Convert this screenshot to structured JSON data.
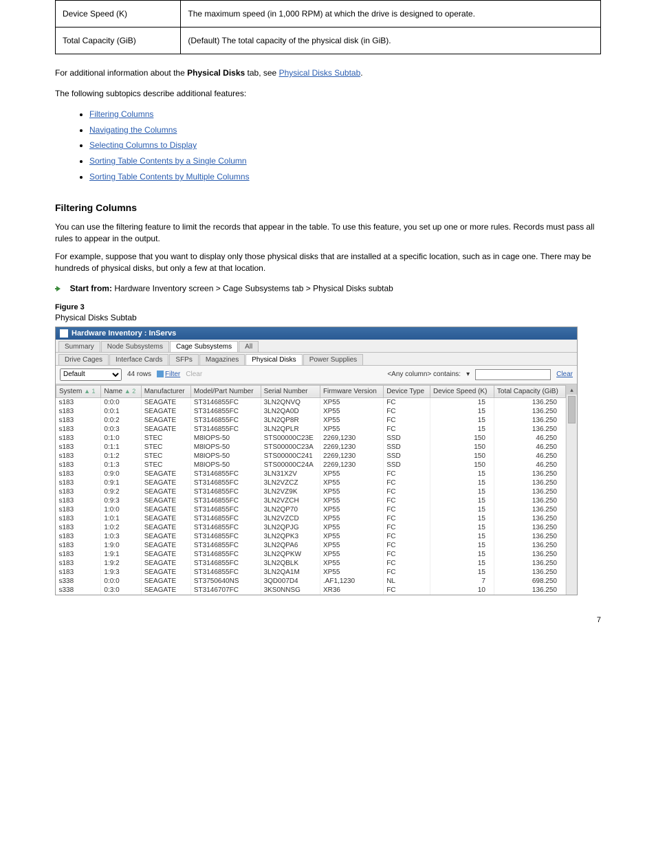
{
  "definitions": [
    {
      "term": "Device Speed (K)",
      "desc": "The maximum speed (in 1,000 RPM) at which the drive is designed to operate."
    },
    {
      "term": "Total Capacity (GiB)",
      "desc": "(Default) The total capacity of the physical disk (in GiB)."
    }
  ],
  "intro": {
    "prefix": "For additional information about the ",
    "bold": "Physical Disks",
    "mid": " tab, see ",
    "link": "Physical Disks Subtab",
    "suffix": "."
  },
  "toc_intro": "The following subtopics describe additional features:",
  "toc": [
    "Filtering Columns",
    "Navigating the Columns",
    "Selecting Columns to Display",
    "Sorting Table Contents by a Single Column",
    "Sorting Table Contents by Multiple Columns"
  ],
  "section_heading": "Filtering Columns",
  "para1": "You can use the filtering feature to limit the records that appear in the table. To use this feature, you set up one or more rules. Records must pass all rules to appear in the output.",
  "para2": "For example, suppose that you want to display only those physical disks that are installed at a specific location, such as in cage one. There may be hundreds of physical disks, but only a few at that location.",
  "nav_label": "Start from:",
  "nav_path": "Hardware Inventory screen > Cage Subsystems tab > Physical Disks subtab",
  "fig_num": "Figure 3",
  "fig_title": "Physical Disks Subtab",
  "screenshot": {
    "title": "Hardware Inventory : InServs",
    "top_tabs": [
      "Summary",
      "Node Subsystems",
      "Cage Subsystems",
      "All"
    ],
    "top_active": 2,
    "sub_tabs": [
      "Drive Cages",
      "Interface Cards",
      "SFPs",
      "Magazines",
      "Physical Disks",
      "Power Supplies"
    ],
    "sub_active": 4,
    "toolbar": {
      "select_value": "Default",
      "rows": "44 rows",
      "filter": "Filter",
      "clear": "Clear",
      "contains": "<Any column> contains:",
      "clear_link": "Clear"
    },
    "columns": [
      "System",
      "Name",
      "Manufacturer",
      "Model/Part Number",
      "Serial Number",
      "Firmware Version",
      "Device Type",
      "Device Speed (K)",
      "Total Capacity (GiB)"
    ],
    "sort1": "▲ 1",
    "sort2": "▲ 2",
    "rows": [
      [
        "s183",
        "0:0:0",
        "SEAGATE",
        "ST3146855FC",
        "3LN2QNVQ",
        "XP55",
        "FC",
        "15",
        "136.250"
      ],
      [
        "s183",
        "0:0:1",
        "SEAGATE",
        "ST3146855FC",
        "3LN2QA0D",
        "XP55",
        "FC",
        "15",
        "136.250"
      ],
      [
        "s183",
        "0:0:2",
        "SEAGATE",
        "ST3146855FC",
        "3LN2QP8R",
        "XP55",
        "FC",
        "15",
        "136.250"
      ],
      [
        "s183",
        "0:0:3",
        "SEAGATE",
        "ST3146855FC",
        "3LN2QPLR",
        "XP55",
        "FC",
        "15",
        "136.250"
      ],
      [
        "s183",
        "0:1:0",
        "STEC",
        "M8IOPS-50",
        "STS00000C23E",
        "2269,1230",
        "SSD",
        "150",
        "46.250"
      ],
      [
        "s183",
        "0:1:1",
        "STEC",
        "M8IOPS-50",
        "STS00000C23A",
        "2269,1230",
        "SSD",
        "150",
        "46.250"
      ],
      [
        "s183",
        "0:1:2",
        "STEC",
        "M8IOPS-50",
        "STS00000C241",
        "2269,1230",
        "SSD",
        "150",
        "46.250"
      ],
      [
        "s183",
        "0:1:3",
        "STEC",
        "M8IOPS-50",
        "STS00000C24A",
        "2269,1230",
        "SSD",
        "150",
        "46.250"
      ],
      [
        "s183",
        "0:9:0",
        "SEAGATE",
        "ST3146855FC",
        "3LN31X2V",
        "XP55",
        "FC",
        "15",
        "136.250"
      ],
      [
        "s183",
        "0:9:1",
        "SEAGATE",
        "ST3146855FC",
        "3LN2VZCZ",
        "XP55",
        "FC",
        "15",
        "136.250"
      ],
      [
        "s183",
        "0:9:2",
        "SEAGATE",
        "ST3146855FC",
        "3LN2VZ9K",
        "XP55",
        "FC",
        "15",
        "136.250"
      ],
      [
        "s183",
        "0:9:3",
        "SEAGATE",
        "ST3146855FC",
        "3LN2VZCH",
        "XP55",
        "FC",
        "15",
        "136.250"
      ],
      [
        "s183",
        "1:0:0",
        "SEAGATE",
        "ST3146855FC",
        "3LN2QP70",
        "XP55",
        "FC",
        "15",
        "136.250"
      ],
      [
        "s183",
        "1:0:1",
        "SEAGATE",
        "ST3146855FC",
        "3LN2VZCD",
        "XP55",
        "FC",
        "15",
        "136.250"
      ],
      [
        "s183",
        "1:0:2",
        "SEAGATE",
        "ST3146855FC",
        "3LN2QPJG",
        "XP55",
        "FC",
        "15",
        "136.250"
      ],
      [
        "s183",
        "1:0:3",
        "SEAGATE",
        "ST3146855FC",
        "3LN2QPK3",
        "XP55",
        "FC",
        "15",
        "136.250"
      ],
      [
        "s183",
        "1:9:0",
        "SEAGATE",
        "ST3146855FC",
        "3LN2QPA6",
        "XP55",
        "FC",
        "15",
        "136.250"
      ],
      [
        "s183",
        "1:9:1",
        "SEAGATE",
        "ST3146855FC",
        "3LN2QPKW",
        "XP55",
        "FC",
        "15",
        "136.250"
      ],
      [
        "s183",
        "1:9:2",
        "SEAGATE",
        "ST3146855FC",
        "3LN2QBLK",
        "XP55",
        "FC",
        "15",
        "136.250"
      ],
      [
        "s183",
        "1:9:3",
        "SEAGATE",
        "ST3146855FC",
        "3LN2QA1M",
        "XP55",
        "FC",
        "15",
        "136.250"
      ],
      [
        "s338",
        "0:0:0",
        "SEAGATE",
        "ST3750640NS",
        "3QD007D4",
        ".AF1,1230",
        "NL",
        "7",
        "698.250"
      ],
      [
        "s338",
        "0:3:0",
        "SEAGATE",
        "ST3146707FC",
        "3KS0NNSG",
        "XR36",
        "FC",
        "10",
        "136.250"
      ]
    ]
  },
  "page_number": "7"
}
